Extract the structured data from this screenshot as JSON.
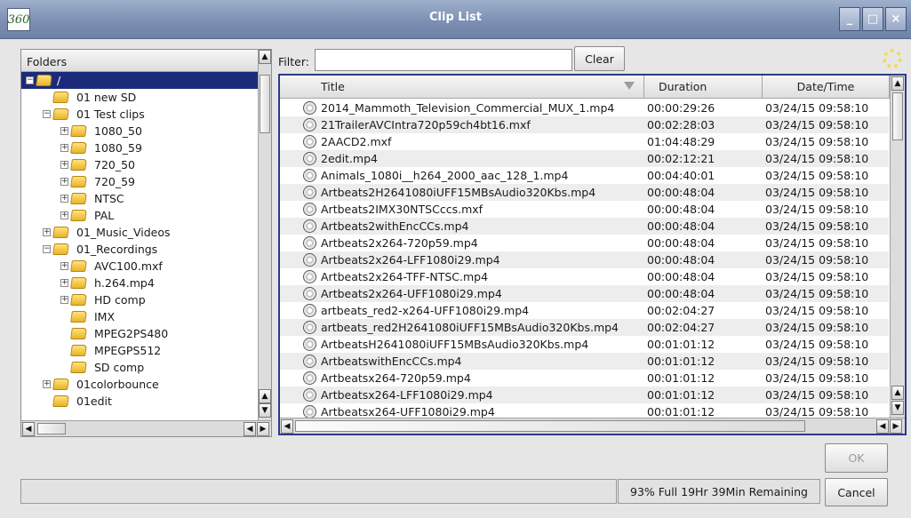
{
  "window": {
    "title": "Clip List",
    "app_icon": "360",
    "buttons": [
      "_",
      "□",
      "×"
    ]
  },
  "folders": {
    "header": "Folders",
    "root": "/",
    "items": [
      {
        "label": "01 new SD",
        "depth": 1,
        "expander": ""
      },
      {
        "label": "01 Test clips",
        "depth": 1,
        "expander": "−"
      },
      {
        "label": "1080_50",
        "depth": 2,
        "expander": "+"
      },
      {
        "label": "1080_59",
        "depth": 2,
        "expander": "+"
      },
      {
        "label": "720_50",
        "depth": 2,
        "expander": "+"
      },
      {
        "label": "720_59",
        "depth": 2,
        "expander": "+"
      },
      {
        "label": "NTSC",
        "depth": 2,
        "expander": "+"
      },
      {
        "label": "PAL",
        "depth": 2,
        "expander": "+"
      },
      {
        "label": "01_Music_Videos",
        "depth": 1,
        "expander": "+"
      },
      {
        "label": "01_Recordings",
        "depth": 1,
        "expander": "−"
      },
      {
        "label": "AVC100.mxf",
        "depth": 2,
        "expander": "+"
      },
      {
        "label": "h.264.mp4",
        "depth": 2,
        "expander": "+"
      },
      {
        "label": "HD comp",
        "depth": 2,
        "expander": "+"
      },
      {
        "label": "IMX",
        "depth": 2,
        "expander": ""
      },
      {
        "label": "MPEG2PS480",
        "depth": 2,
        "expander": ""
      },
      {
        "label": "MPEGPS512",
        "depth": 2,
        "expander": ""
      },
      {
        "label": "SD comp",
        "depth": 2,
        "expander": ""
      },
      {
        "label": "01colorbounce",
        "depth": 1,
        "expander": "+"
      },
      {
        "label": "01edit",
        "depth": 1,
        "expander": ""
      }
    ]
  },
  "filter": {
    "label": "Filter:",
    "value": "",
    "clear_label": "Clear"
  },
  "clips": {
    "columns": [
      "Title",
      "Duration",
      "Date/Time"
    ],
    "rows": [
      {
        "title": "2014_Mammoth_Television_Commercial_MUX_1.mp4",
        "duration": "00:00:29:26",
        "datetime": "03/24/15 09:58:10"
      },
      {
        "title": "21TrailerAVCIntra720p59ch4bt16.mxf",
        "duration": "00:02:28:03",
        "datetime": "03/24/15 09:58:10"
      },
      {
        "title": "2AACD2.mxf",
        "duration": "01:04:48:29",
        "datetime": "03/24/15 09:58:10"
      },
      {
        "title": "2edit.mp4",
        "duration": "00:02:12:21",
        "datetime": "03/24/15 09:58:10"
      },
      {
        "title": "Animals_1080i__h264_2000_aac_128_1.mp4",
        "duration": "00:04:40:01",
        "datetime": "03/24/15 09:58:10"
      },
      {
        "title": "Artbeats2H2641080iUFF15MBsAudio320Kbs.mp4",
        "duration": "00:00:48:04",
        "datetime": "03/24/15 09:58:10"
      },
      {
        "title": "Artbeats2IMX30NTSCccs.mxf",
        "duration": "00:00:48:04",
        "datetime": "03/24/15 09:58:10"
      },
      {
        "title": "Artbeats2withEncCCs.mp4",
        "duration": "00:00:48:04",
        "datetime": "03/24/15 09:58:10"
      },
      {
        "title": "Artbeats2x264-720p59.mp4",
        "duration": "00:00:48:04",
        "datetime": "03/24/15 09:58:10"
      },
      {
        "title": "Artbeats2x264-LFF1080i29.mp4",
        "duration": "00:00:48:04",
        "datetime": "03/24/15 09:58:10"
      },
      {
        "title": "Artbeats2x264-TFF-NTSC.mp4",
        "duration": "00:00:48:04",
        "datetime": "03/24/15 09:58:10"
      },
      {
        "title": "Artbeats2x264-UFF1080i29.mp4",
        "duration": "00:00:48:04",
        "datetime": "03/24/15 09:58:10"
      },
      {
        "title": "artbeats_red2-x264-UFF1080i29.mp4",
        "duration": "00:02:04:27",
        "datetime": "03/24/15 09:58:10"
      },
      {
        "title": "artbeats_red2H2641080iUFF15MBsAudio320Kbs.mp4",
        "duration": "00:02:04:27",
        "datetime": "03/24/15 09:58:10"
      },
      {
        "title": "ArtbeatsH2641080iUFF15MBsAudio320Kbs.mp4",
        "duration": "00:01:01:12",
        "datetime": "03/24/15 09:58:10"
      },
      {
        "title": "ArtbeatswithEncCCs.mp4",
        "duration": "00:01:01:12",
        "datetime": "03/24/15 09:58:10"
      },
      {
        "title": "Artbeatsx264-720p59.mp4",
        "duration": "00:01:01:12",
        "datetime": "03/24/15 09:58:10"
      },
      {
        "title": "Artbeatsx264-LFF1080i29.mp4",
        "duration": "00:01:01:12",
        "datetime": "03/24/15 09:58:10"
      },
      {
        "title": "Artbeatsx264-UFF1080i29.mp4",
        "duration": "00:01:01:12",
        "datetime": "03/24/15 09:58:10"
      }
    ]
  },
  "status": {
    "disk": "93% Full  19Hr 39Min Remaining"
  },
  "actions": {
    "ok_label": "OK",
    "cancel_label": "Cancel"
  },
  "colors": {
    "titlebar": "#8093b6",
    "selection": "#1c2a7a",
    "accent_border": "#2c3c86"
  }
}
